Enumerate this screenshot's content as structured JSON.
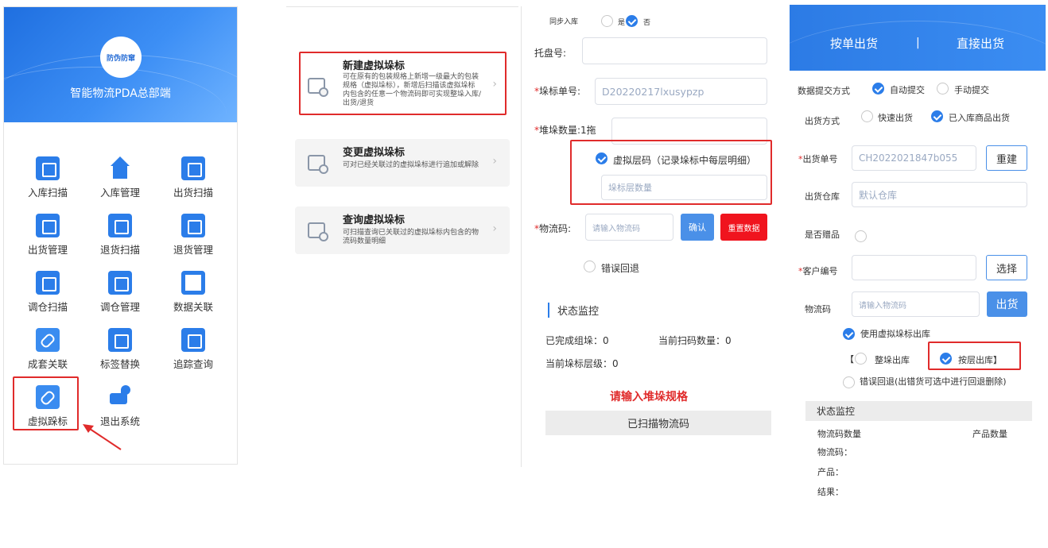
{
  "panel1": {
    "app_title": "智能物流PDA总部端",
    "logo_text": "防伪防窜",
    "items": [
      {
        "label": "入库扫描",
        "icon": "chart-box-icon"
      },
      {
        "label": "入库管理",
        "icon": "warehouse-icon"
      },
      {
        "label": "出货扫描",
        "icon": "box-download-icon"
      },
      {
        "label": "出货管理",
        "icon": "grid-gear-icon"
      },
      {
        "label": "退货扫描",
        "icon": "box-return-icon"
      },
      {
        "label": "退货管理",
        "icon": "clipboard-return-icon"
      },
      {
        "label": "调仓扫描",
        "icon": "clipboard-return-icon"
      },
      {
        "label": "调仓管理",
        "icon": "clipboard-return-icon"
      },
      {
        "label": "数据关联",
        "icon": "share-circle-icon"
      },
      {
        "label": "成套关联",
        "icon": "link-icon"
      },
      {
        "label": "标签替换",
        "icon": "swap-icon"
      },
      {
        "label": "追踪查询",
        "icon": "exit-door-icon"
      },
      {
        "label": "虚拟跺标",
        "icon": "link-icon"
      },
      {
        "label": "退出系统",
        "icon": "truck-location-icon"
      }
    ]
  },
  "panel2": {
    "cards": [
      {
        "title": "新建虚拟垛标",
        "desc": "可在原有的包装规格上新增一级最大的包装规格（虚拟垛标），新增后扫描该虚拟垛标内包含的任意一个物流码即可实现整垛入库/出货/退货"
      },
      {
        "title": "变更虚拟垛标",
        "desc": "可对已经关联过的虚拟垛标进行追加或解除"
      },
      {
        "title": "查询虚拟垛标",
        "desc": "可扫描查询已关联过的虚拟垛标内包含的物流码数量明细"
      }
    ]
  },
  "panel3": {
    "sync_label": "同步入库",
    "sync_yes": "是",
    "sync_no": "否",
    "tray_label": "托盘号:",
    "pile_no_label": "垛标单号:",
    "pile_no_value": "D20220217lxusypzp",
    "stack_label": "堆垛数量:1拖",
    "virtual_layer_label": "虚拟层码（记录垛标中每层明细）",
    "layer_placeholder": "垛标层数量",
    "logistics_label": "物流码:",
    "logistics_placeholder": "请输入物流码",
    "confirm_btn": "确认",
    "reset_btn": "重置数据",
    "error_rollback": "错误回退",
    "status_title": "状态监控",
    "done_groups": "已完成组垛：0",
    "scan_count": "当前扫码数量：0",
    "current_layer": "当前垛标层级：0",
    "warning": "请输入堆垛规格",
    "scanned_bar": "已扫描物流码"
  },
  "panel4": {
    "tab1": "按单出货",
    "tab_sep": "|",
    "tab2": "直接出货",
    "submit_label": "数据提交方式",
    "submit_auto": "自动提交",
    "submit_manual": "手动提交",
    "ship_method_label": "出货方式",
    "ship_fast": "快速出货",
    "ship_stock": "已入库商品出货",
    "order_no_label": "出货单号",
    "order_no_value": "CH2022021847b055",
    "rebuild_btn": "重建",
    "warehouse_label": "出货仓库",
    "warehouse_value": "默认仓库",
    "gift_label": "是否赠品",
    "customer_label": "客户编号",
    "select_btn": "选择",
    "logistics_label": "物流码",
    "logistics_placeholder": "请输入物流码",
    "ship_btn": "出货",
    "use_virtual": "使用虚拟垛标出库",
    "bracket_open": "【",
    "whole_pile": "整垛出库",
    "by_layer": "按层出库】",
    "error_rollback": "错误回退(出错货可选中进行回退删除)",
    "status_title": "状态监控",
    "col1": "物流码数量",
    "col2": "产品数量",
    "row1": "物流码：",
    "row2": "产品：",
    "row3": "结果："
  },
  "colors": {
    "primary": "#2b7de9",
    "highlight": "#e02b2b",
    "reset": "#f0141e"
  }
}
